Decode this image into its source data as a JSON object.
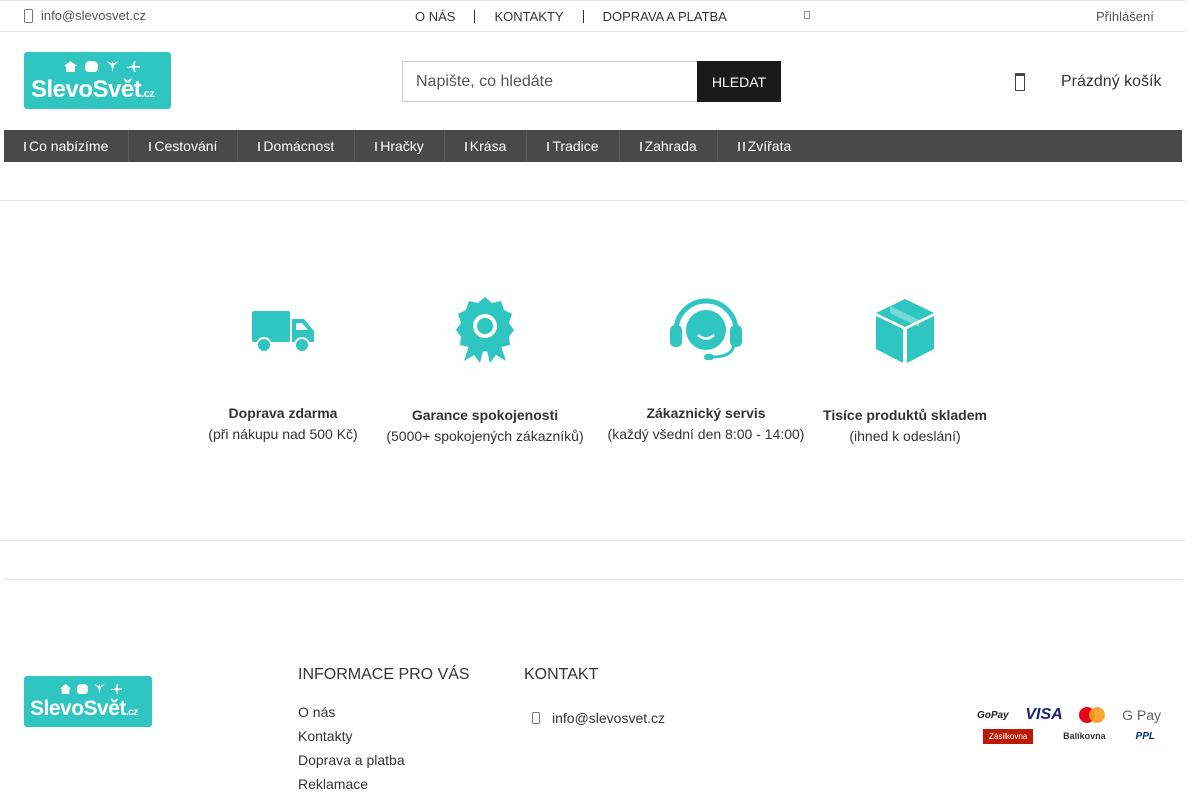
{
  "topbar": {
    "email": "info@slevosvet.cz",
    "nav": [
      "O nás",
      "Kontakty",
      "Doprava a platba"
    ],
    "login": "Přihlášení"
  },
  "logo": {
    "main": "SlevoSvět",
    "tld": ".cz"
  },
  "search": {
    "placeholder": "Napište, co hledáte",
    "button": "HLEDAT"
  },
  "cart": {
    "label": "Prázdný košík"
  },
  "categories": [
    "Co nabízíme",
    "Cestování",
    "Domácnost",
    "Hračky",
    "Krása",
    "Tradice",
    "Zahrada",
    "Zvířata"
  ],
  "features": [
    {
      "title": "Doprava zdarma",
      "subtitle": "(při nákupu nad 500 Kč)",
      "icon": "truck-icon"
    },
    {
      "title": "Garance spokojenosti",
      "subtitle": "(5000+ spokojených zákazníků)",
      "icon": "award-icon"
    },
    {
      "title": "Zákaznický servis",
      "subtitle": "(každý všední den 8:00 - 14:00)",
      "icon": "headset-icon"
    },
    {
      "title": "Tisíce produktů skladem",
      "subtitle": "(ihned k odeslání)",
      "icon": "box-icon"
    }
  ],
  "footer": {
    "info_title": "INFORMACE PRO VÁS",
    "info_links": [
      "O nás",
      "Kontakty",
      "Doprava a platba",
      "Reklamace"
    ],
    "contact_title": "KONTAKT",
    "contact_email": "info@slevosvet.cz",
    "payments": {
      "gopay": "GoPay",
      "visa": "VISA",
      "gpay": "G Pay",
      "zasilkovna": "Zásilkovna",
      "balikovna": "Balíkovna",
      "ppl": "PPL"
    }
  },
  "colors": {
    "brand": "#2fc6c2",
    "catbar": "#494949",
    "button": "#1a1a1a"
  }
}
